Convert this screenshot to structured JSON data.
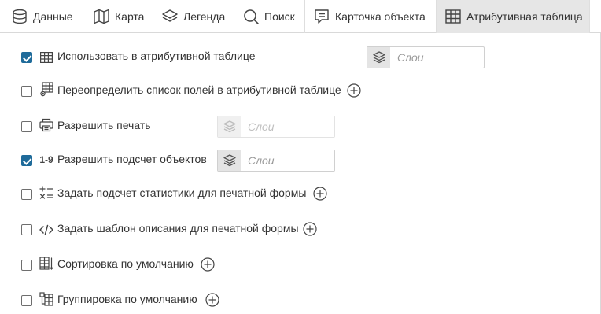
{
  "tabs": [
    {
      "label": "Данные",
      "icon": "database-icon",
      "active": false
    },
    {
      "label": "Карта",
      "icon": "map-icon",
      "active": false
    },
    {
      "label": "Легенда",
      "icon": "layers-icon",
      "active": false
    },
    {
      "label": "Поиск",
      "icon": "search-icon",
      "active": false
    },
    {
      "label": "Карточка объекта",
      "icon": "feature-card-icon",
      "active": false
    },
    {
      "label": "Атрибутивная таблица",
      "icon": "table-icon",
      "active": true
    }
  ],
  "options": [
    {
      "label": "Использовать в атрибутивной таблице",
      "checked": true,
      "icon": "table-icon",
      "layers_placeholder": "Слои",
      "layers_enabled": true
    },
    {
      "label": "Переопределить список полей в атрибутивной таблице",
      "checked": false,
      "icon": "table-settings-icon",
      "has_add": true
    },
    {
      "label": "Разрешить печать",
      "checked": false,
      "icon": "printer-icon",
      "layers_placeholder": "Слои",
      "layers_enabled": false
    },
    {
      "label": "Разрешить подсчет объектов",
      "checked": true,
      "icon": "count-icon",
      "icon_text": "1-9",
      "layers_placeholder": "Слои",
      "layers_enabled": true
    },
    {
      "label": "Задать подсчет статистики для печатной формы",
      "checked": false,
      "icon": "math-operations-icon",
      "has_add": true
    },
    {
      "label": "Задать шаблон описания для печатной формы",
      "checked": false,
      "icon": "code-icon",
      "has_add": true
    },
    {
      "label": "Сортировка по умолчанию",
      "checked": false,
      "icon": "sort-icon",
      "has_add": true
    },
    {
      "label": "Группировка по умолчанию",
      "checked": false,
      "icon": "group-icon",
      "has_add": true
    }
  ],
  "colors": {
    "accent": "#1f6b9a",
    "active_tab": "#e6e6e6",
    "border": "#d9d9d9"
  }
}
